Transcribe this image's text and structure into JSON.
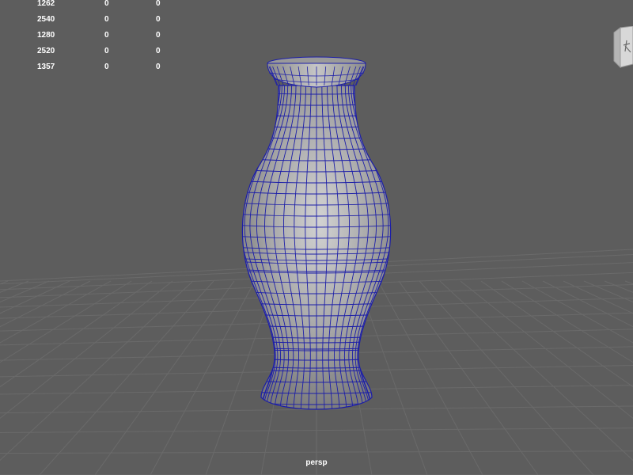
{
  "viewport": {
    "camera_label": "persp",
    "background_color": "#5d5d5d",
    "grid_color": "#6a6a6a",
    "wireframe_color": "#1c1ea8"
  },
  "heads_up_display": {
    "rows": [
      [
        "1262",
        "0",
        "0"
      ],
      [
        "2540",
        "0",
        "0"
      ],
      [
        "1280",
        "0",
        "0"
      ],
      [
        "2520",
        "0",
        "0"
      ],
      [
        "1357",
        "0",
        "0"
      ]
    ]
  },
  "view_cube": {
    "icon": "view-cube-icon"
  }
}
